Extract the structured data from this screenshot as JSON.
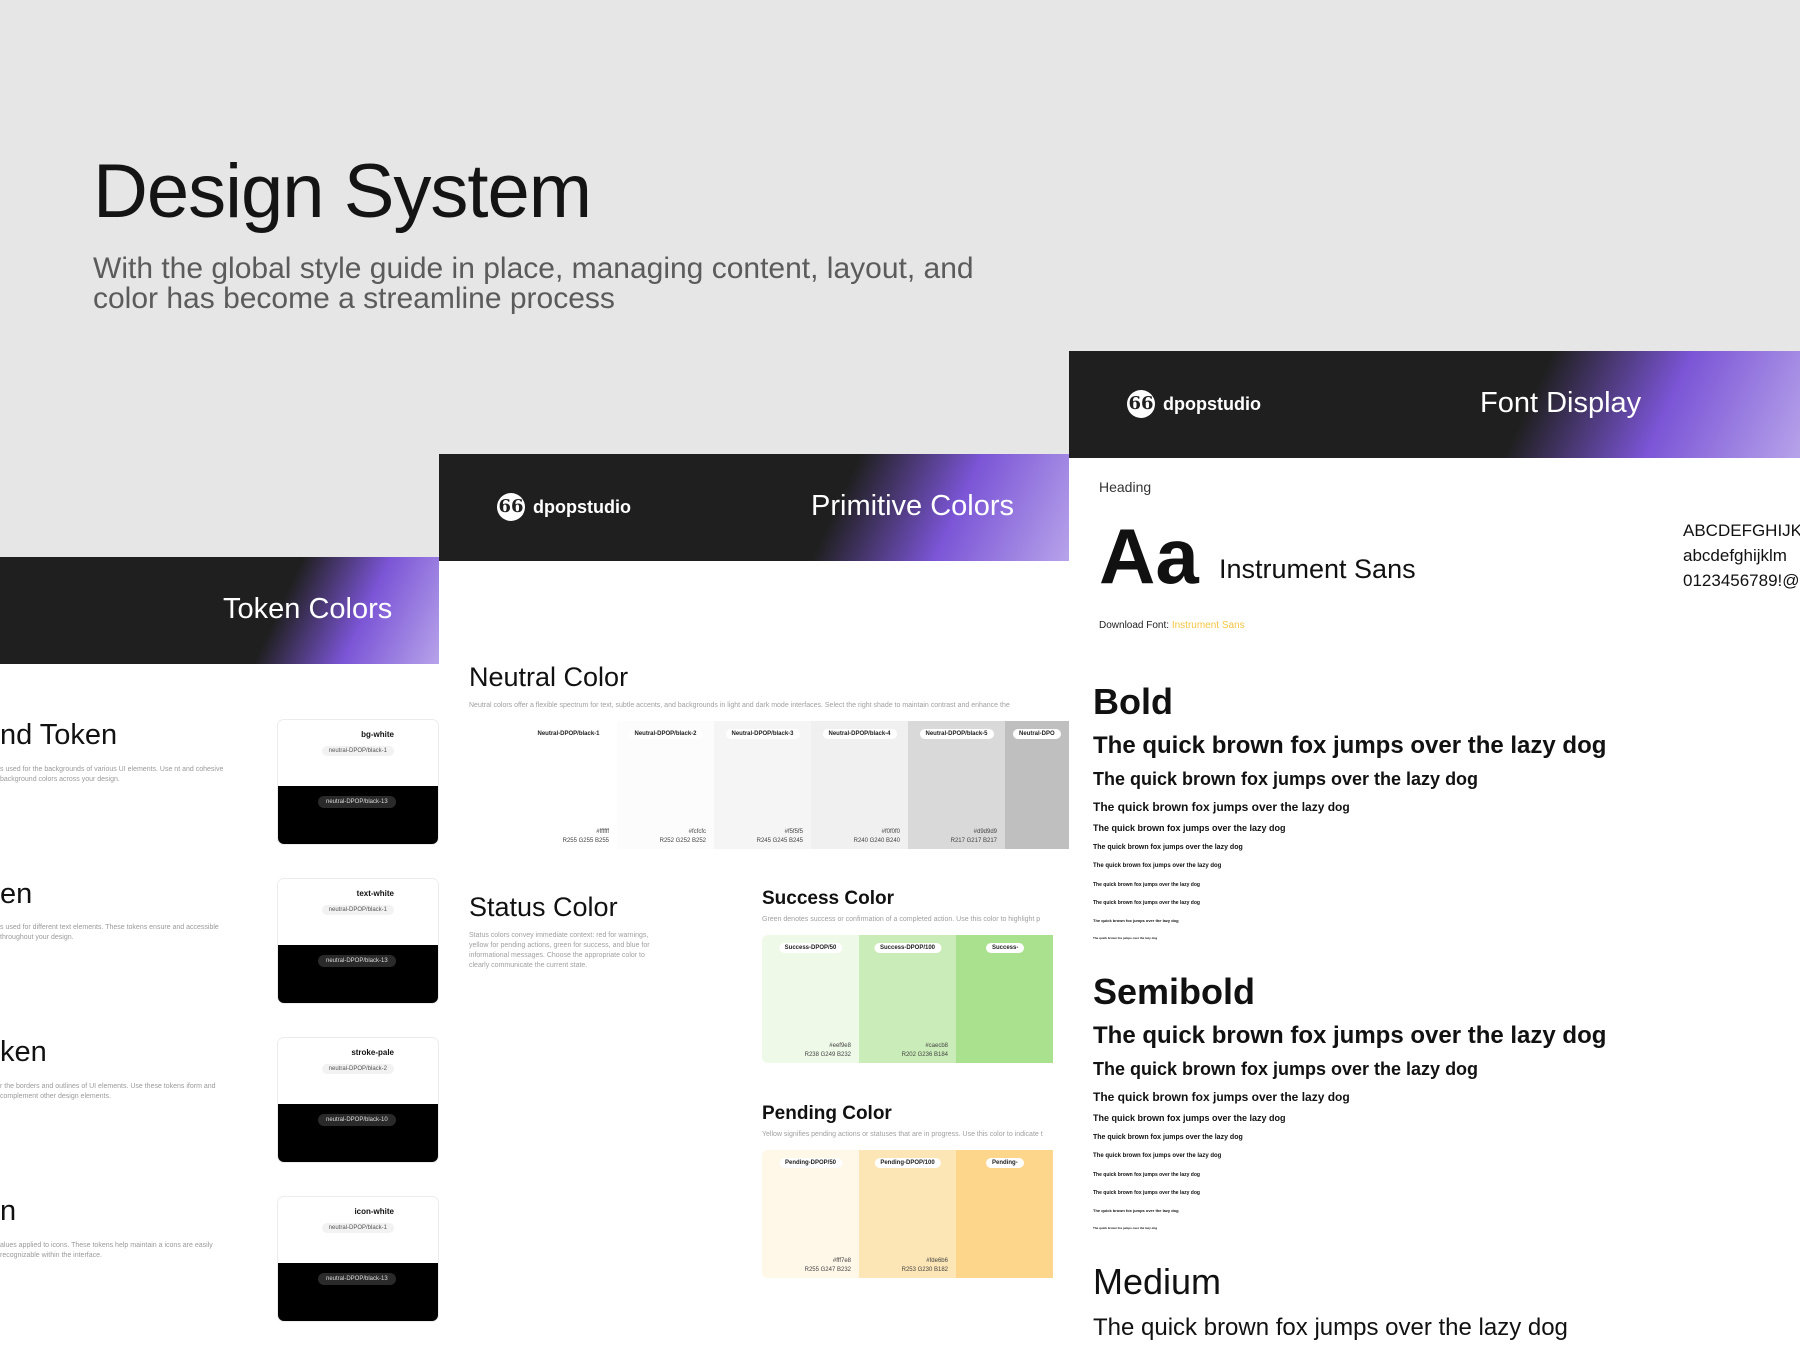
{
  "hero": {
    "title": "Design System",
    "subtitle": "With the global style guide in place, managing content, layout, and color has become a streamline process"
  },
  "brand": {
    "logo_glyph": "66",
    "name": "dpopstudio"
  },
  "token_panel": {
    "title": "Token Colors",
    "sections": [
      {
        "name": "nd Token",
        "desc": "s used for the backgrounds of various UI elements. Use nt and cohesive background colors across your design.",
        "label": "bg-white",
        "label_extra": "b",
        "pill": "neutral-DPOP/black-1",
        "pill_dark": "neutral-DPOP/black-13"
      },
      {
        "name": "en",
        "desc": "s used for different text elements. These tokens ensure and accessible throughout your design.",
        "label": "text-white",
        "label_extra": "te",
        "pill": "neutral-DPOP/black-1",
        "pill_dark": "neutral-DPOP/black-13"
      },
      {
        "name": "ken",
        "desc": "r the borders and outlines of UI elements. Use these tokens iform and complement other design elements.",
        "label": "stroke-pale",
        "label_extra": "",
        "pill": "neutral-DPOP/black-2",
        "pill_dark": "neutral-DPOP/black-10"
      },
      {
        "name": "n",
        "desc": "alues applied to icons. These tokens help maintain a icons are easily recognizable within the interface.",
        "label": "icon-white",
        "label_extra": "ic",
        "pill": "neutral-DPOP/black-1",
        "pill_dark": "neutral-DPOP/black-13"
      }
    ]
  },
  "primitive_panel": {
    "title": "Primitive Colors",
    "neutral": {
      "heading": "Neutral Color",
      "desc": "Neutral colors offer a flexible spectrum for text, subtle accents, and backgrounds in light and dark mode interfaces. Select the right shade to maintain contrast and enhance the",
      "swatches": [
        {
          "name": "Neutral-DPOP/black-1",
          "hex": "#ffffff",
          "rgb": "R255 G255 B255",
          "color": "#ffffff"
        },
        {
          "name": "Neutral-DPOP/black-2",
          "hex": "#fcfcfc",
          "rgb": "R252 G252 B252",
          "color": "#fcfcfc"
        },
        {
          "name": "Neutral-DPOP/black-3",
          "hex": "#f5f5f5",
          "rgb": "R245 G245 B245",
          "color": "#f5f5f5"
        },
        {
          "name": "Neutral-DPOP/black-4",
          "hex": "#f0f0f0",
          "rgb": "R240 G240 B240",
          "color": "#f0f0f0"
        },
        {
          "name": "Neutral-DPOP/black-5",
          "hex": "#d9d9d9",
          "rgb": "R217 G217 B217",
          "color": "#d9d9d9"
        },
        {
          "name": "Neutral-DPO",
          "hex": "",
          "rgb": "",
          "color": "#bfbfbf"
        }
      ]
    },
    "status": {
      "heading": "Status Color",
      "desc": "Status colors convey immediate context: red for warnings, yellow for pending actions, green for success, and blue for informational messages. Choose the appropriate color to clearly communicate the current state."
    },
    "success": {
      "heading": "Success Color",
      "desc": "Green denotes success or confirmation of a completed action. Use this color to highlight p",
      "swatches": [
        {
          "name": "Success-DPOP/50",
          "hex": "#eef9e8",
          "rgb": "R238 G249 B232",
          "color": "#eef9e8"
        },
        {
          "name": "Success-DPOP/100",
          "hex": "#caecb8",
          "rgb": "R202 G236 B184",
          "color": "#caecb8"
        },
        {
          "name": "Success-",
          "hex": "",
          "rgb": "",
          "color": "#a9e18f"
        }
      ]
    },
    "pending": {
      "heading": "Pending Color",
      "desc": "Yellow signifies pending actions or statuses that are in progress. Use this color to indicate t",
      "swatches": [
        {
          "name": "Pending-DPOP/50",
          "hex": "#fff7e8",
          "rgb": "R255 G247 B232",
          "color": "#fff7e8"
        },
        {
          "name": "Pending-DPOP/100",
          "hex": "#fde6b6",
          "rgb": "R253 G230 B182",
          "color": "#fde6b6"
        },
        {
          "name": "Pending-",
          "hex": "",
          "rgb": "",
          "color": "#fdd68b"
        }
      ]
    }
  },
  "font_panel": {
    "title": "Font Display",
    "heading_label": "Heading",
    "sample_glyph": "Aa",
    "font_name": "Instrument Sans",
    "download_label": "Download Font:",
    "download_link": "Instrument Sans",
    "alphabet_upper": "ABCDEFGHIJK",
    "alphabet_lower": "abcdefghijklm",
    "digits": "0123456789!@",
    "pangram": "The quick brown fox jumps over the lazy dog",
    "weights": [
      "Bold",
      "Semibold",
      "Medium"
    ]
  }
}
